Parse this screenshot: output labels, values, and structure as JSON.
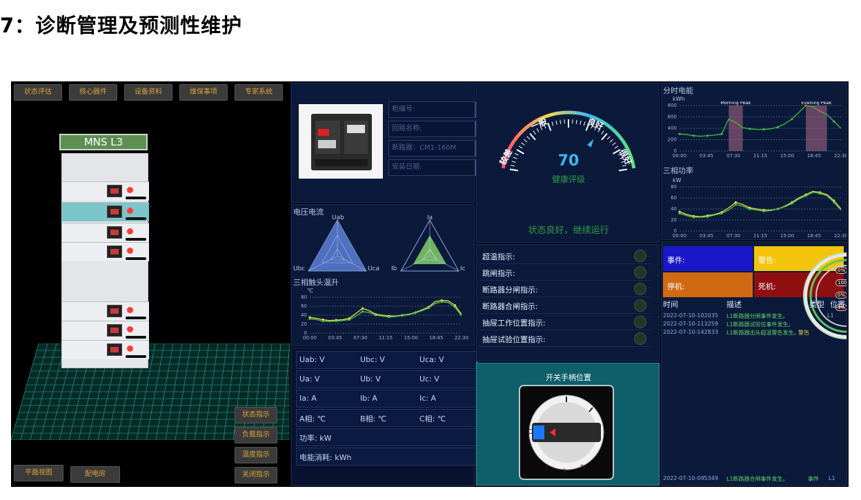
{
  "heading": "7：诊断管理及预测性维护",
  "left": {
    "top_buttons": [
      "状态评估",
      "核心器件",
      "设备资料",
      "维保事项",
      "专家系统"
    ],
    "side_buttons": [
      "状态指示",
      "负载指示",
      "温度指示",
      "关闭指示"
    ],
    "bottom_buttons": [
      "平面视图",
      "配电房"
    ],
    "cabinet_label": "MNS  L3"
  },
  "info": {
    "fields": [
      "柜编号:",
      "回路名称:",
      "断路器：CM1-160M",
      "安装日期:"
    ]
  },
  "voltage_current": {
    "title": "电压电流",
    "v_labels": [
      "Uab",
      "Ubc",
      "Uca"
    ],
    "i_labels": [
      "Ia",
      "Ib",
      "Ic"
    ]
  },
  "temp": {
    "title": "三相触头温升",
    "unit": "℃",
    "x_ticks": [
      "00:00",
      "03:45",
      "07:30",
      "11:15",
      "15:00",
      "18:45",
      "22:30"
    ],
    "y_ticks": [
      "0",
      "20",
      "40",
      "60",
      "80"
    ]
  },
  "measures": [
    [
      "Uab: V",
      "Ubc: V",
      "Uca: V"
    ],
    [
      "Ua: V",
      "Ub: V",
      "Uc: V"
    ],
    [
      "Ia: A",
      "Ib: A",
      "Ic: A"
    ],
    [
      "A相: ℃",
      "B相: ℃",
      "C相: ℃"
    ],
    [
      "功率: kW"
    ],
    [
      "电能消耗: kWh"
    ]
  ],
  "health": {
    "score": "70",
    "score_label": "健康评级",
    "levels": [
      "较差",
      "一般",
      "良好",
      "很好"
    ],
    "status": "状态良好，继续运行",
    "score_value": 70
  },
  "indicators": [
    "超温指示:",
    "跳闸指示:",
    "断路器分闸指示:",
    "断路器合闸指示:",
    "抽屉工作位置指示:",
    "抽屉试验位置指示:"
  ],
  "switch": {
    "title": "开关手柄位置",
    "marks": [
      "O",
      "I",
      "II",
      "IV"
    ]
  },
  "energy": {
    "title": "分时电能",
    "unit": "kWh",
    "y_ticks": [
      "0",
      "200",
      "400",
      "600",
      "800"
    ],
    "x_ticks": [
      "00:00",
      "03:45",
      "07:30",
      "11:15",
      "15:00",
      "18:45",
      "22:30"
    ],
    "peak_labels": [
      "Morning Peak",
      "Evening Peak"
    ]
  },
  "power": {
    "title": "三相功率",
    "unit": "kW",
    "y_ticks": [
      "0",
      "20",
      "40",
      "60",
      "80"
    ],
    "x_ticks": [
      "00:00",
      "03:45",
      "07:30",
      "11:15",
      "15:00",
      "18:45",
      "22:30"
    ]
  },
  "events": {
    "boxes": [
      "事件:",
      "警告:",
      "停机:",
      "死机:"
    ],
    "box_colors": [
      "#1a17c9",
      "#f2c40c",
      "#cf6a12",
      "#8e0f0f"
    ],
    "headers": [
      "时间",
      "描述",
      "类型",
      "位置"
    ],
    "rows": [
      [
        "2022-07-10-102035",
        "L1断路器分闸事件发生。",
        "",
        "L1"
      ],
      [
        "2022-07-10-113259",
        "L1断路器试验位事件发生。",
        "",
        ""
      ],
      [
        "2022-07-10-142833",
        "L1断路器出头超温警告发生。",
        "警告",
        ""
      ]
    ],
    "footer": [
      "2022-07-10-095349",
      "L1断路器合闸事件发生。",
      "事件",
      "L1"
    ],
    "ring_labels": [
      "0%",
      "100%",
      "0%",
      "0%"
    ]
  },
  "chart_data": [
    {
      "type": "line",
      "title": "三相触头温升",
      "ylabel": "℃",
      "x": [
        "00:00",
        "01:00",
        "02:00",
        "03:00",
        "04:00",
        "05:00",
        "06:00",
        "07:00",
        "08:00",
        "09:00",
        "10:00",
        "11:00",
        "12:00",
        "13:00",
        "14:00",
        "15:00",
        "16:00",
        "17:00",
        "18:00",
        "19:00",
        "20:00",
        "21:00",
        "22:00",
        "23:00"
      ],
      "x_ticks": [
        "00:00",
        "03:45",
        "07:30",
        "11:15",
        "15:00",
        "18:45",
        "22:30"
      ],
      "ylim": [
        0,
        80
      ],
      "series": [
        {
          "values": [
            35,
            33,
            30,
            28,
            29,
            30,
            33,
            44,
            55,
            50,
            42,
            40,
            38,
            38,
            40,
            42,
            46,
            52,
            58,
            70,
            73,
            72,
            62,
            42
          ]
        },
        {
          "values": [
            32,
            30,
            27,
            26,
            27,
            28,
            30,
            38,
            48,
            46,
            40,
            38,
            36,
            37,
            39,
            41,
            45,
            50,
            56,
            66,
            70,
            68,
            58,
            38
          ]
        }
      ],
      "colors": [
        "#f2e24a",
        "#4ac94a"
      ]
    },
    {
      "type": "line",
      "title": "分时电能",
      "ylabel": "kWh",
      "x": [
        "00:00",
        "01:00",
        "02:00",
        "03:00",
        "04:00",
        "05:00",
        "06:00",
        "07:00",
        "08:00",
        "09:00",
        "10:00",
        "11:00",
        "12:00",
        "13:00",
        "14:00",
        "15:00",
        "16:00",
        "17:00",
        "18:00",
        "19:00",
        "20:00",
        "21:00",
        "22:00",
        "23:00"
      ],
      "x_ticks": [
        "00:00",
        "03:45",
        "07:30",
        "11:15",
        "15:00",
        "18:45",
        "22:30"
      ],
      "ylim": [
        0,
        800
      ],
      "series": [
        {
          "values": [
            300,
            290,
            270,
            260,
            270,
            280,
            300,
            560,
            500,
            410,
            390,
            380,
            380,
            390,
            420,
            480,
            560,
            680,
            800,
            780,
            700,
            640,
            520,
            400
          ]
        }
      ],
      "colors": [
        "#3fbf3f"
      ],
      "peaks": [
        [
          "07:00",
          "09:00"
        ],
        [
          "18:00",
          "21:00"
        ]
      ]
    },
    {
      "type": "line",
      "title": "三相功率",
      "ylabel": "kW",
      "x": [
        "00:00",
        "01:00",
        "02:00",
        "03:00",
        "04:00",
        "05:00",
        "06:00",
        "07:00",
        "08:00",
        "09:00",
        "10:00",
        "11:00",
        "12:00",
        "13:00",
        "14:00",
        "15:00",
        "16:00",
        "17:00",
        "18:00",
        "19:00",
        "20:00",
        "21:00",
        "22:00",
        "23:00"
      ],
      "x_ticks": [
        "00:00",
        "03:45",
        "07:30",
        "11:15",
        "15:00",
        "18:45",
        "22:30"
      ],
      "ylim": [
        0,
        80
      ],
      "series": [
        {
          "values": [
            35,
            30,
            27,
            26,
            28,
            30,
            34,
            42,
            52,
            48,
            42,
            40,
            38,
            38,
            40,
            45,
            52,
            60,
            66,
            72,
            70,
            66,
            55,
            40
          ]
        },
        {
          "values": [
            32,
            28,
            25,
            25,
            26,
            29,
            32,
            38,
            48,
            45,
            40,
            38,
            36,
            37,
            40,
            44,
            50,
            58,
            64,
            70,
            68,
            64,
            52,
            38
          ]
        }
      ],
      "colors": [
        "#f2e24a",
        "#4ac94a"
      ]
    }
  ]
}
